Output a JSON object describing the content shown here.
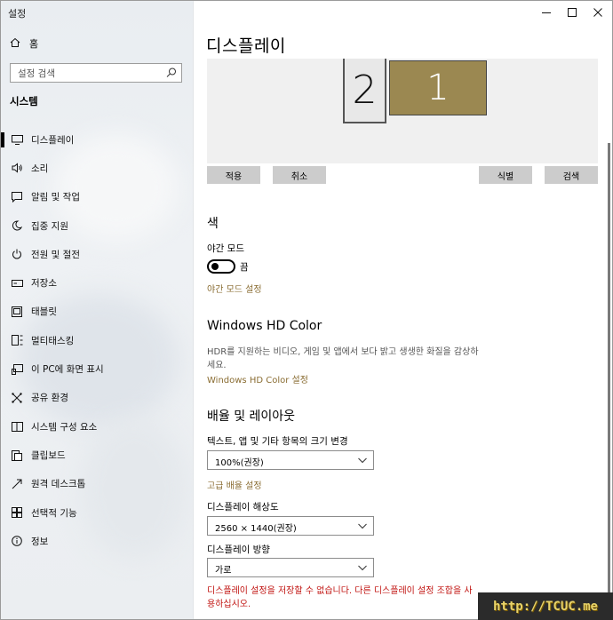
{
  "window": {
    "title": "설정",
    "controls": [
      "minimize",
      "maximize",
      "close"
    ]
  },
  "sidebar": {
    "home_label": "홈",
    "search_placeholder": "설정 검색",
    "section_label": "시스템",
    "items": [
      {
        "label": "디스플레이",
        "icon": "monitor-icon",
        "active": true
      },
      {
        "label": "소리",
        "icon": "speaker-icon"
      },
      {
        "label": "알림 및 작업",
        "icon": "notification-icon"
      },
      {
        "label": "집중 지원",
        "icon": "moon-icon"
      },
      {
        "label": "전원 및 절전",
        "icon": "power-icon"
      },
      {
        "label": "저장소",
        "icon": "storage-icon"
      },
      {
        "label": "태블릿",
        "icon": "tablet-icon"
      },
      {
        "label": "멀티태스킹",
        "icon": "multitasking-icon"
      },
      {
        "label": "이 PC에 화면 표시",
        "icon": "project-icon"
      },
      {
        "label": "공유 환경",
        "icon": "share-icon"
      },
      {
        "label": "시스템 구성 요소",
        "icon": "components-icon"
      },
      {
        "label": "클립보드",
        "icon": "clipboard-icon"
      },
      {
        "label": "원격 데스크톱",
        "icon": "remote-desktop-icon"
      },
      {
        "label": "선택적 기능",
        "icon": "features-icon"
      },
      {
        "label": "정보",
        "icon": "info-icon"
      }
    ]
  },
  "main": {
    "title": "디스플레이",
    "monitors": [
      "2",
      "1"
    ],
    "buttons": {
      "apply": "적용",
      "cancel": "취소",
      "identify": "식별",
      "detect": "검색"
    },
    "color_section": {
      "heading": "색",
      "night_light_label": "야간 모드",
      "night_light_state": "끔",
      "night_light_link": "야간 모드 설정"
    },
    "hdr_section": {
      "heading": "Windows HD Color",
      "description": "HDR를 지원하는 비디오, 게임 및 앱에서 보다 밝고 생생한 화질을 감상하세요.",
      "link": "Windows HD Color 설정"
    },
    "layout_section": {
      "heading": "배율 및 레이아웃",
      "scale_label": "텍스트, 앱 및 기타 항목의 크기 변경",
      "scale_value": "100%(권장)",
      "advanced_link": "고급 배율 설정",
      "resolution_label": "디스플레이 해상도",
      "resolution_value": "2560 × 1440(권장)",
      "orientation_label": "디스플레이 방향",
      "orientation_value": "가로"
    },
    "error_text": "디스플레이 설정을 저장할 수 없습니다. 다른 디스플레이 설정 조합을 사용하십시오."
  },
  "watermark": "http://TCUC.me",
  "colors": {
    "accent": "#8a6d33",
    "monitor_primary": "#9b8851",
    "error": "#c0120f"
  }
}
